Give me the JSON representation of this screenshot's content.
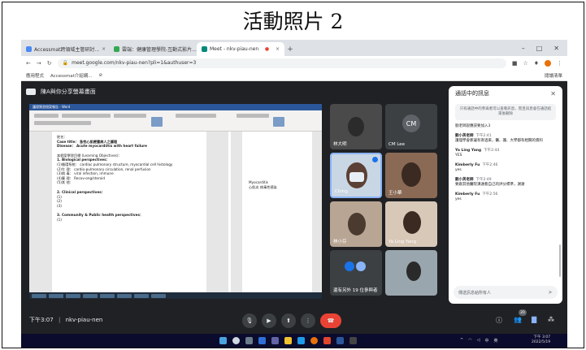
{
  "caption": "活動照片 2",
  "browser": {
    "tabs": [
      {
        "label": "Accessmat跨領域主管研討...",
        "active": false
      },
      {
        "label": "雲端：健康管理學院-互動式影片...",
        "active": false
      },
      {
        "label": "Meet - nkv-piau-nen",
        "active": true
      }
    ],
    "new_tab": "+",
    "url": "meet.google.com/nkv-piau-nen?pli=1&authuser=3",
    "bookmarks": [
      "應用程式",
      "Accessmat介紹網..."
    ],
    "bookmarks_right": "閱讀清單",
    "win_min": "–",
    "win_max": "□",
    "win_close": "✕"
  },
  "meet": {
    "presenting_label": "陳A與你分享螢幕畫面",
    "meeting_time": "下午3:07",
    "meeting_code": "nkv-piau-nen",
    "participant_count": "20"
  },
  "document": {
    "title": "護理實習個案報告 - Word",
    "lines": [
      {
        "text": "姓名：",
        "bold": false
      },
      {
        "text": "Case title： 急性心肌梗塞病人之護理",
        "bold": true
      },
      {
        "text": "Disease： Acute myocardiitis with heart failure",
        "bold": true
      },
      {
        "text": "本個案學習目標 (Learning Objectives)：",
        "bold": false
      },
      {
        "text": "1. Biological perspectives：",
        "bold": true
      },
      {
        "text": "(1)循環系統： cardiac pulmonary structure, myocardial cell histology",
        "bold": false
      },
      {
        "text": "(2)生 理： cardio-pulmonary circulation, renal perfusion",
        "bold": false
      },
      {
        "text": "(3)病 毒： viral infection, immune",
        "bold": false
      },
      {
        "text": "(4)藥 理： Recov-ong/steroid",
        "bold": false
      },
      {
        "text": "(5)其 他：",
        "bold": false
      },
      {
        "text": "2. Clinical perspectives：",
        "bold": true
      },
      {
        "text": "(1)",
        "bold": false
      },
      {
        "text": "(2)",
        "bold": false
      },
      {
        "text": "(3)",
        "bold": false
      },
      {
        "text": "3. Community & Public health perspectives：",
        "bold": true
      },
      {
        "text": "(1)",
        "bold": false
      }
    ],
    "side_note": [
      "Myocarditis",
      "心肌炎 病毒性感染"
    ]
  },
  "participants": [
    {
      "name": "林大明",
      "type": "video"
    },
    {
      "name": "CM Lee",
      "type": "avatar",
      "initials": "CM"
    },
    {
      "name": "Ching",
      "type": "video"
    },
    {
      "name": "王小華",
      "type": "video"
    },
    {
      "name": "林小芬",
      "type": "video"
    },
    {
      "name": "Ya Ling Yang",
      "type": "video"
    },
    {
      "name": "還有另外 19 位參與者",
      "type": "more"
    },
    {
      "name": "",
      "type": "video"
    }
  ],
  "chat": {
    "title": "通話中的訊息",
    "notice": "只有通話中的參與者可以查看訊息，而且訊息會在通話結束後刪除",
    "messages": [
      {
        "who": "",
        "time": "",
        "text": "劉老師說應該要加入3"
      },
      {
        "who": "劉小英老師",
        "time": "下午2:41",
        "text": "護理學會那邊有寄過來，醫、護、大學都有相關的資料"
      },
      {
        "who": "Ya Ling Yang",
        "time": "下午2:44",
        "text": "YES"
      },
      {
        "who": "Kimberly Fu",
        "time": "下午2:46",
        "text": "yes"
      },
      {
        "who": "劉小英老師",
        "time": "下午2:49",
        "text": "要跟其他醫院溝通看自己的評分標準，謝謝"
      },
      {
        "who": "Kimberly Fu",
        "time": "下午2:56",
        "text": "yes"
      }
    ],
    "input_placeholder": "傳送訊息給所有人"
  },
  "taskbar": {
    "time": "下午 3:07",
    "date": "2022/5/19",
    "tray": [
      "^",
      "中",
      "英"
    ]
  }
}
